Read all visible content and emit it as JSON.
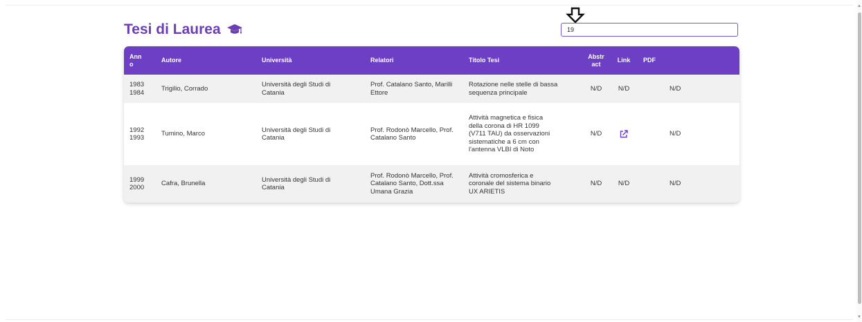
{
  "page": {
    "title": "Tesi di Laurea",
    "title_icon": "graduation-cap-icon",
    "accent_color": "#6c3fc4",
    "title_color": "#6b3fb3"
  },
  "search": {
    "value": "19",
    "placeholder": ""
  },
  "annotation": {
    "icon": "down-arrow-icon"
  },
  "table": {
    "headers": {
      "anno": "Anno",
      "autore": "Autore",
      "universita": "Università",
      "relatori": "Relatori",
      "titolo": "Titolo Tesi",
      "abstract": "Abstract",
      "link": "Link",
      "pdf": "PDF"
    },
    "rows": [
      {
        "anno_start": "1983",
        "anno_end": "1984",
        "autore": "Trigilio, Corrado",
        "universita": "Università degli Studi di Catania",
        "relatori": "Prof. Catalano Santo, Marilli Ettore",
        "titolo": "Rotazione nelle stelle di bassa sequenza principale",
        "abstract": "N/D",
        "link": "N/D",
        "pdf": "N/D"
      },
      {
        "anno_start": "1992",
        "anno_end": "1993",
        "autore": "Tumino, Marco",
        "universita": "Università degli Studi di Catania",
        "relatori": "Prof. Rodonò Marcello, Prof. Catalano Santo",
        "titolo": "Attività magnetica e fisica della corona di HR 1099 (V711 TAU) da osservazioni sistematiche a 6 cm con l'antenna VLBI di Noto",
        "abstract": "N/D",
        "link_icon": "external-link-icon",
        "pdf": "N/D"
      },
      {
        "anno_start": "1999",
        "anno_end": "2000",
        "autore": "Cafra, Brunella",
        "universita": "Università degli Studi di Catania",
        "relatori": "Prof. Rodonò Marcello, Prof. Catalano Santo, Dott.ssa Umana Grazia",
        "titolo": "Attività cromosferica e coronale del sistema binario UX ARIETIS",
        "abstract": "N/D",
        "link": "N/D",
        "pdf": "N/D"
      }
    ]
  }
}
